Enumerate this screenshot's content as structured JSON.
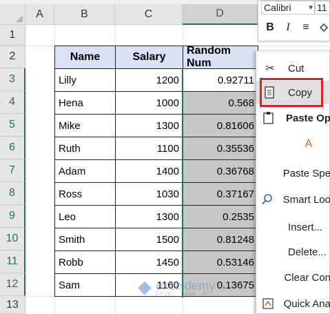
{
  "columns": [
    "A",
    "B",
    "C",
    "D"
  ],
  "rows": [
    "1",
    "2",
    "3",
    "4",
    "5",
    "6",
    "7",
    "8",
    "9",
    "10",
    "11",
    "12",
    "13"
  ],
  "table": {
    "headers": [
      "Name",
      "Salary",
      "Random Num"
    ],
    "rows": [
      {
        "name": "Lilly",
        "salary": "1200",
        "random": "0.92711"
      },
      {
        "name": "Hena",
        "salary": "1000",
        "random": "0.568"
      },
      {
        "name": "Mike",
        "salary": "1300",
        "random": "0.81606"
      },
      {
        "name": "Ruth",
        "salary": "1100",
        "random": "0.35536"
      },
      {
        "name": "Adam",
        "salary": "1400",
        "random": "0.36768"
      },
      {
        "name": "Ross",
        "salary": "1030",
        "random": "0.37167"
      },
      {
        "name": "Leo",
        "salary": "1300",
        "random": "0.2535"
      },
      {
        "name": "Smith",
        "salary": "1500",
        "random": "0.81248"
      },
      {
        "name": "Robb",
        "salary": "1450",
        "random": "0.53146"
      },
      {
        "name": "Sam",
        "salary": "1160",
        "random": "0.13675"
      }
    ]
  },
  "minibar": {
    "font": "Calibri",
    "size": "11",
    "bold": "B",
    "italic": "I",
    "align": "≡"
  },
  "context_menu": {
    "items": [
      {
        "label": "Cut",
        "icon": "scissors-icon",
        "glyph": "✂"
      },
      {
        "label": "Copy",
        "icon": "copy-icon",
        "glyph": "⎘"
      },
      {
        "label": "Paste Op",
        "icon": "paste-icon",
        "glyph": "📋"
      },
      {
        "label": "",
        "icon": "paste-format-icon",
        "glyph": "A"
      },
      {
        "label": "Paste Spe",
        "icon": "",
        "glyph": ""
      },
      {
        "label": "Smart Loo",
        "icon": "search-icon",
        "glyph": "⌕"
      },
      {
        "label": "Insert...",
        "icon": "",
        "glyph": ""
      },
      {
        "label": "Delete...",
        "icon": "",
        "glyph": ""
      },
      {
        "label": "Clear Con",
        "icon": "",
        "glyph": ""
      },
      {
        "label": "Quick Ana",
        "icon": "quick-analysis-icon",
        "glyph": "▦"
      }
    ]
  },
  "watermark": {
    "name": "exceldemy",
    "tagline": "EXCEL · DATA · BI"
  },
  "colors": {
    "accent": "#217346",
    "header_fill": "#d9e1f2",
    "highlight_border": "#e02020"
  }
}
